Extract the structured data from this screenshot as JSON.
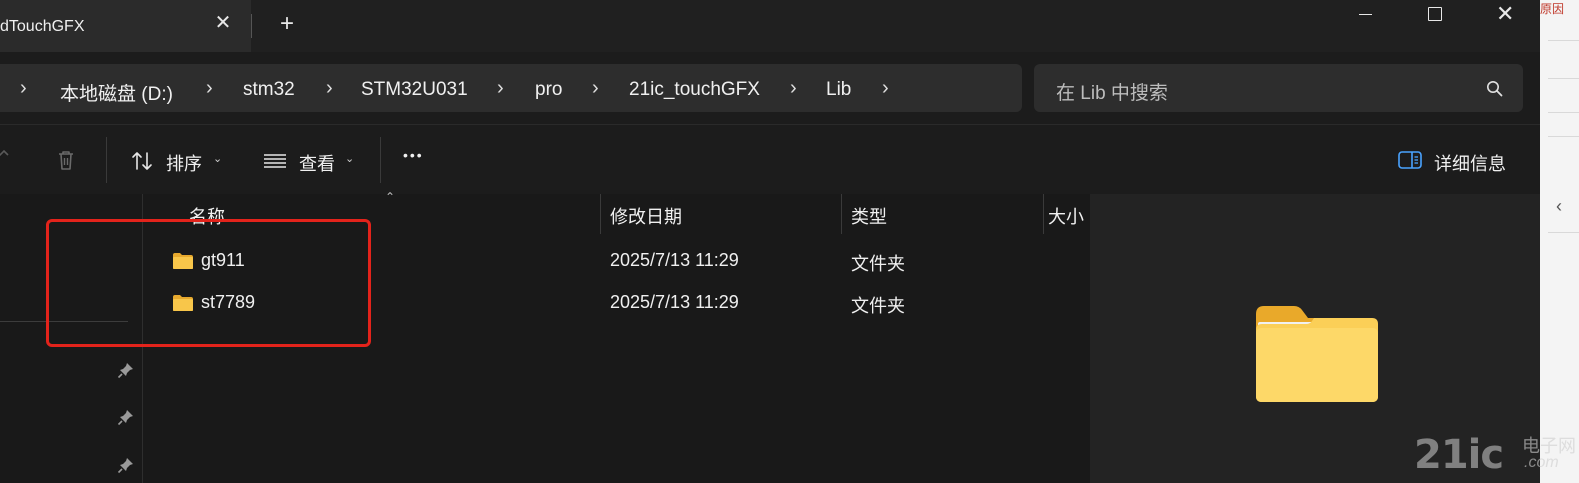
{
  "tab": {
    "title": "dTouchGFX",
    "close_symbol": "✕",
    "new_tab_symbol": "+"
  },
  "window": {
    "close_symbol": "✕"
  },
  "breadcrumb": [
    "本地磁盘 (D:)",
    "stm32",
    "STM32U031",
    "pro",
    "21ic_touchGFX",
    "Lib"
  ],
  "breadcrumb_chevron": "›",
  "search": {
    "placeholder": "在 Lib 中搜索"
  },
  "toolbar": {
    "sort_label": "排序",
    "view_label": "查看",
    "more_label": "•••",
    "details_label": "详细信息",
    "caret": "⌄"
  },
  "columns": {
    "name": "名称",
    "date": "修改日期",
    "type": "类型",
    "size": "大小",
    "sort_arrow": "⌃"
  },
  "files": [
    {
      "name": "gt911",
      "date": "2025/7/13 11:29",
      "type": "文件夹"
    },
    {
      "name": "st7789",
      "date": "2025/7/13 11:29",
      "type": "文件夹"
    }
  ],
  "right_strip": {
    "text": "原因",
    "chevron": "‹"
  },
  "watermark": {
    "number": "21ic",
    "cn": "电子网",
    "com": ".com"
  },
  "colors": {
    "accent_red": "#e3231b",
    "folder_yellow": "#f8c64a"
  }
}
